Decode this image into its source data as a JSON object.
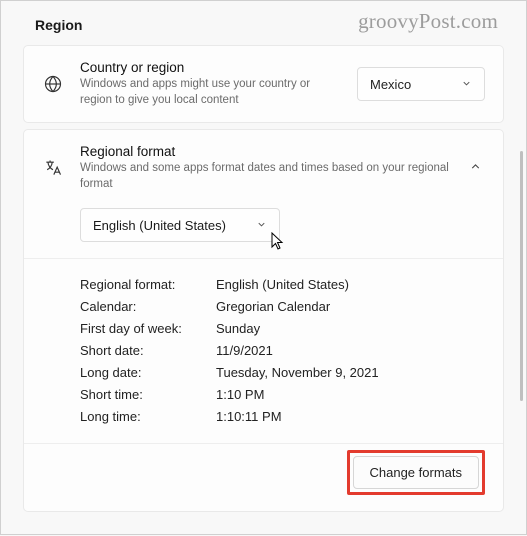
{
  "watermark": "groovyPost.com",
  "page_title": "Region",
  "country_card": {
    "title": "Country or region",
    "subtitle": "Windows and apps might use your country or region to give you local content",
    "selected": "Mexico"
  },
  "regional_card": {
    "title": "Regional format",
    "subtitle": "Windows and some apps format dates and times based on your regional format",
    "selected": "English (United States)",
    "rows": [
      {
        "key": "Regional format:",
        "val": "English (United States)"
      },
      {
        "key": "Calendar:",
        "val": "Gregorian Calendar"
      },
      {
        "key": "First day of week:",
        "val": "Sunday"
      },
      {
        "key": "Short date:",
        "val": "11/9/2021"
      },
      {
        "key": "Long date:",
        "val": "Tuesday, November 9, 2021"
      },
      {
        "key": "Short time:",
        "val": "1:10 PM"
      },
      {
        "key": "Long time:",
        "val": "1:10:11 PM"
      }
    ],
    "change_button": "Change formats"
  }
}
